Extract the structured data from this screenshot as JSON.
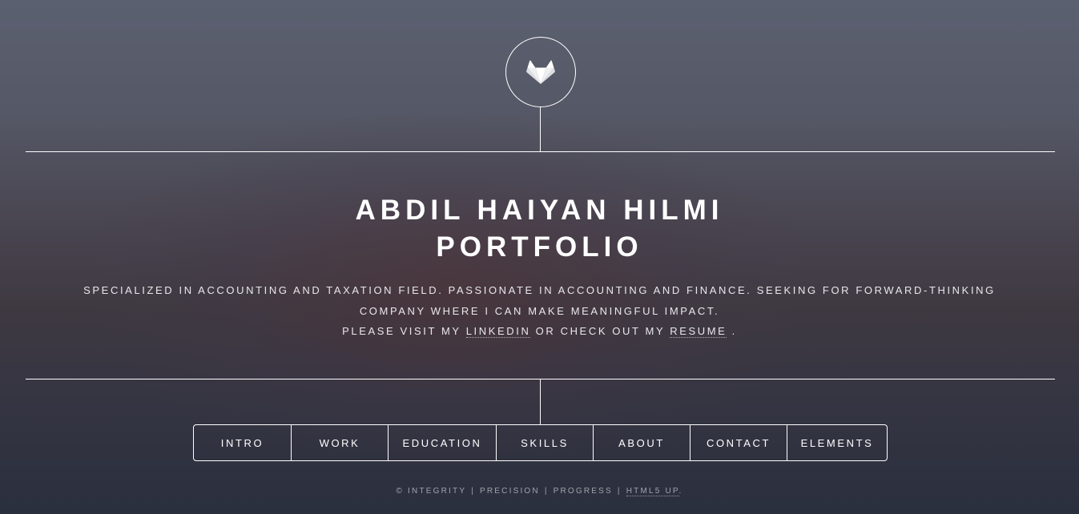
{
  "header": {
    "logo_icon": "gitlab-fox-icon",
    "title_line1": "ABDIL HAIYAN HILMI",
    "title_line2": "PORTFOLIO"
  },
  "intro": {
    "line1": "SPECIALIZED IN ACCOUNTING AND TAXATION FIELD. PASSIONATE IN ACCOUNTING AND FINANCE. SEEKING FOR FORWARD-THINKING COMPANY WHERE I CAN MAKE MEANINGFUL IMPACT.",
    "line2_prefix": "PLEASE VISIT MY",
    "linkedin_label": "LINKEDIN",
    "line2_middle": "OR CHECK OUT MY",
    "resume_label": "RESUME",
    "line2_suffix": "."
  },
  "nav": {
    "items": [
      {
        "label": "INTRO"
      },
      {
        "label": "WORK"
      },
      {
        "label": "EDUCATION"
      },
      {
        "label": "SKILLS"
      },
      {
        "label": "ABOUT"
      },
      {
        "label": "CONTACT"
      },
      {
        "label": "ELEMENTS"
      }
    ]
  },
  "footer": {
    "copyright": "© INTEGRITY",
    "item2": "PRECISION",
    "item3": "PROGRESS",
    "link_label": "HTML5 UP",
    "end": ".",
    "separator": "|"
  },
  "colors": {
    "text": "#ffffff",
    "line": "#ffffff"
  }
}
